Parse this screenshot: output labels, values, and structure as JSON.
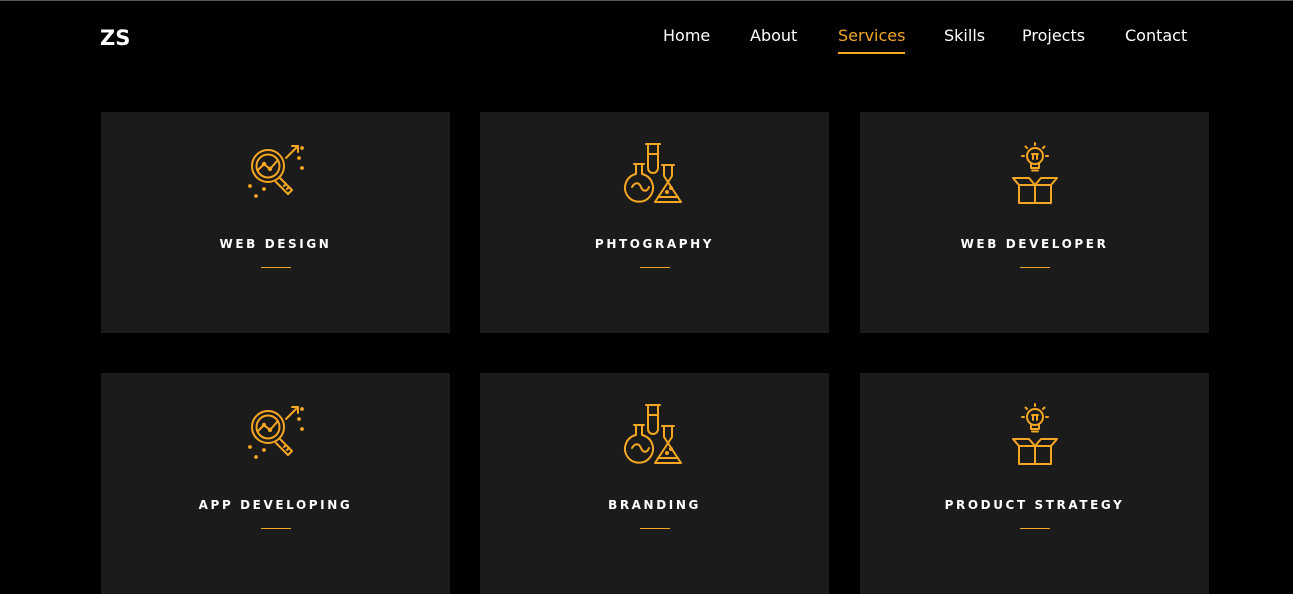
{
  "logo": "ZS",
  "nav": {
    "items": [
      {
        "label": "Home"
      },
      {
        "label": "About"
      },
      {
        "label": "Services",
        "active": true
      },
      {
        "label": "Skills"
      },
      {
        "label": "Projects"
      },
      {
        "label": "Contact"
      }
    ]
  },
  "colors": {
    "background": "#000000",
    "card": "#1b1b1b",
    "accent": "#f5a623",
    "text": "#ffffff"
  },
  "services": [
    {
      "title": "WEB DESIGN",
      "icon": "magnifier-chart-icon"
    },
    {
      "title": "PHTOGRAPHY",
      "icon": "lab-flasks-icon"
    },
    {
      "title": "WEB DEVELOPER",
      "icon": "lightbulb-box-icon"
    },
    {
      "title": "APP DEVELOPING",
      "icon": "magnifier-chart-icon"
    },
    {
      "title": "BRANDING",
      "icon": "lab-flasks-icon"
    },
    {
      "title": "PRODUCT STRATEGY",
      "icon": "lightbulb-box-icon"
    }
  ]
}
